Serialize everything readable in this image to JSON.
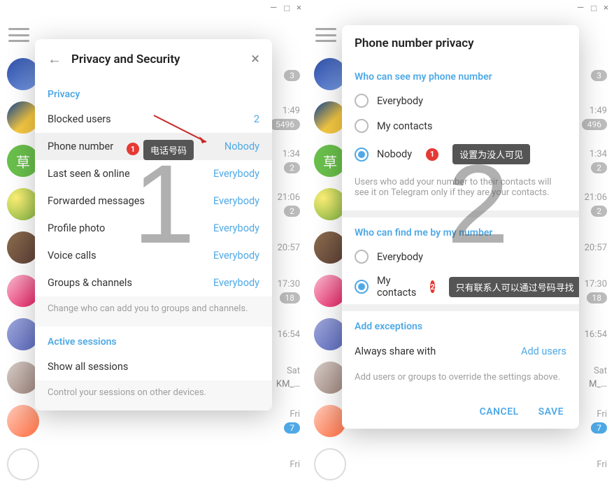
{
  "left": {
    "window": {
      "min": "—",
      "max": "□",
      "close": "×"
    },
    "dialog": {
      "back": "←",
      "title": "Privacy and Security",
      "close": "×",
      "privacy_label": "Privacy",
      "rows": {
        "blocked": {
          "label": "Blocked users",
          "value": "2"
        },
        "phone": {
          "label": "Phone number",
          "value": "Nobody"
        },
        "lastseen": {
          "label": "Last seen & online",
          "value": "Everybody"
        },
        "forwarded": {
          "label": "Forwarded messages",
          "value": "Everybody"
        },
        "photo": {
          "label": "Profile photo",
          "value": "Everybody"
        },
        "calls": {
          "label": "Voice calls",
          "value": "Everybody"
        },
        "groups": {
          "label": "Groups & channels",
          "value": "Everybody"
        }
      },
      "groups_hint": "Change who can add you to groups and channels.",
      "sessions_label": "Active sessions",
      "show_sessions": "Show all sessions",
      "sessions_hint": "Control your sessions on other devices."
    },
    "callouts": {
      "phone_num_badge": "1",
      "phone_tooltip": "电话号码",
      "big_num": "1"
    },
    "chats": [
      {
        "avatar": "c1",
        "time": "",
        "badge": "3",
        "badge_cls": ""
      },
      {
        "avatar": "c2",
        "time": "1:49",
        "badge": "5496",
        "badge_cls": ""
      },
      {
        "avatar": "c3",
        "glyph": "草",
        "time": "1:34",
        "badge": "2",
        "badge_cls": ""
      },
      {
        "avatar": "c4",
        "time": "21:06",
        "badge": "2",
        "badge_cls": ""
      },
      {
        "avatar": "c5",
        "time": "20:57",
        "badge": "",
        "badge_cls": ""
      },
      {
        "avatar": "c6",
        "time": "17:30",
        "badge": "18",
        "badge_cls": ""
      },
      {
        "avatar": "c7",
        "time": "16:54",
        "badge": "",
        "badge_cls": ""
      },
      {
        "avatar": "c8",
        "time": "Sat",
        "badge": "KM_…",
        "badge_cls": "plain"
      },
      {
        "avatar": "c9",
        "time": "Fri",
        "badge": "7",
        "badge_cls": "blue"
      },
      {
        "avatar": "c10",
        "time": "Fri",
        "badge": "",
        "badge_cls": ""
      }
    ]
  },
  "right": {
    "window": {
      "min": "—",
      "max": "□",
      "close": "×"
    },
    "dialog": {
      "title": "Phone number privacy",
      "see_label": "Who can see my phone number",
      "see_options": {
        "everybody": "Everybody",
        "contacts": "My contacts",
        "nobody": "Nobody"
      },
      "see_hint": "Users who add your number to their contacts will see it on Telegram only if they are your contacts.",
      "find_label": "Who can find me by my number",
      "find_options": {
        "everybody": "Everybody",
        "contacts": "My contacts"
      },
      "exceptions_label": "Add exceptions",
      "always_share": "Always share with",
      "add_users": "Add users",
      "exceptions_hint": "Add users or groups to override the settings above.",
      "cancel": "CANCEL",
      "save": "SAVE"
    },
    "callouts": {
      "nobody_badge": "1",
      "nobody_tooltip": "设置为没人可见",
      "contacts_badge": "2",
      "contacts_tooltip": "只有联系人可以通过号码寻找",
      "big_num": "2"
    },
    "chats": [
      {
        "avatar": "c1",
        "time": "",
        "badge": "3",
        "badge_cls": ""
      },
      {
        "avatar": "c2",
        "time": "1:49",
        "badge": "496",
        "badge_cls": ""
      },
      {
        "avatar": "c3",
        "glyph": "草",
        "time": "1:34",
        "badge": "2",
        "badge_cls": ""
      },
      {
        "avatar": "c4",
        "time": "21:06",
        "badge": "2",
        "badge_cls": ""
      },
      {
        "avatar": "c5",
        "time": "20:57",
        "badge": "",
        "badge_cls": ""
      },
      {
        "avatar": "c6",
        "time": "17:30",
        "badge": "18",
        "badge_cls": ""
      },
      {
        "avatar": "c7",
        "time": "16:54",
        "badge": "",
        "badge_cls": ""
      },
      {
        "avatar": "c8",
        "time": "Sat",
        "badge": "M_…",
        "badge_cls": "plain"
      },
      {
        "avatar": "c9",
        "time": "Fri",
        "badge": "7",
        "badge_cls": "blue"
      },
      {
        "avatar": "c10",
        "time": "Fri",
        "badge": "",
        "badge_cls": ""
      }
    ]
  }
}
